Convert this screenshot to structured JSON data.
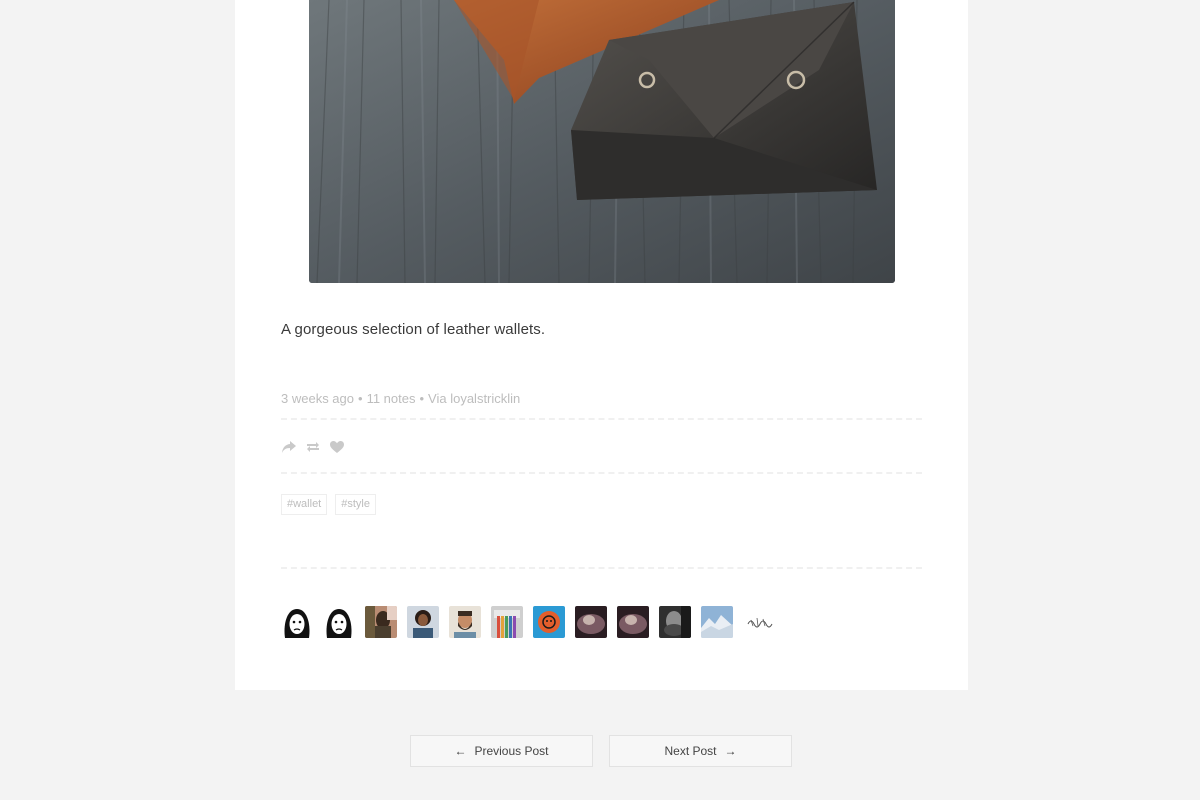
{
  "post": {
    "caption": "A gorgeous selection of leather wallets.",
    "meta": {
      "time": "3 weeks ago",
      "notes": "11 notes",
      "via": "Via loyalstricklin"
    },
    "actions": [
      {
        "name": "share-icon"
      },
      {
        "name": "reblog-icon"
      },
      {
        "name": "like-heart-icon"
      }
    ],
    "tags": [
      "#wallet",
      "#style"
    ],
    "note_avatars_count": 12
  },
  "navigation": {
    "previous_label": "Previous Post",
    "next_label": "Next Post"
  },
  "colors": {
    "page_bg": "#f3f3f3",
    "card_bg": "#ffffff",
    "meta_text": "#bdbdbd",
    "body_text": "#3a3a3a"
  }
}
